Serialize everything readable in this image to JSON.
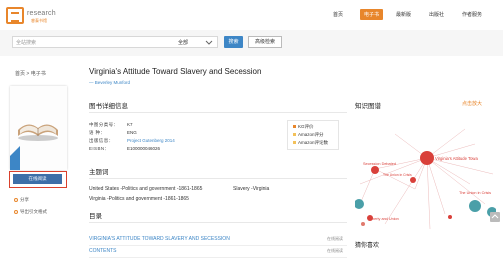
{
  "header": {
    "logo_text": "research",
    "logo_sub": "睿泰书馆",
    "nav": [
      {
        "label": "首页",
        "active": false
      },
      {
        "label": "电子书",
        "active": true
      },
      {
        "label": "最新版",
        "active": false
      },
      {
        "label": "出版社",
        "active": false
      },
      {
        "label": "作者服务",
        "active": false
      }
    ]
  },
  "search": {
    "placeholder": "全站搜索",
    "scope": "全部",
    "button": "搜索",
    "advanced": "高级检索"
  },
  "breadcrumb": "首页 > 电子书",
  "left": {
    "read_button": "在线阅读",
    "share": "分享",
    "export": "导出引文格式"
  },
  "book": {
    "title": "Virginia's Attitude Toward Slavery and Secession",
    "author": "— Beverley Munford"
  },
  "details": {
    "heading": "图书详细信息",
    "rows": [
      {
        "key": "中图分类号：",
        "value": "K7",
        "link": false
      },
      {
        "key": "语    种：",
        "value": "ENG",
        "link": false
      },
      {
        "key": "出版信息：",
        "value": "Project Gutenberg 2014",
        "link": true
      },
      {
        "key": "EISBN：",
        "value": "E100000046026",
        "link": false
      }
    ],
    "ratings": [
      {
        "label": "KG评价",
        "color": "#e8862b"
      },
      {
        "label": "Amazon评分",
        "color": "#f3c15a"
      },
      {
        "label": "Amazon评论数",
        "color": "#f3c15a"
      }
    ]
  },
  "subject": {
    "heading": "主题词",
    "line1a": "United States -Politics and government -1861-1865",
    "line1b": "Slavery -Virginia",
    "line2": "Virginia -Politics and government -1861-1865"
  },
  "toc": {
    "heading": "目录",
    "items": [
      {
        "label": "VIRGINIA'S ATTITUDE TOWARD SLAVERY AND SECESSION",
        "read": "在线阅读"
      },
      {
        "label": "CONTENTS",
        "read": "在线阅读"
      }
    ]
  },
  "knowledge_graph": {
    "heading": "知识图谱",
    "expand": "点击放大",
    "nodes": [
      {
        "label": "Virginia's Attitude Towa",
        "color": "#d9403a"
      },
      {
        "label": "Secession Debated",
        "color": "#d9403a"
      },
      {
        "label": "Liberty and Union",
        "color": "#d9403a"
      },
      {
        "label": "The Union in Crisis",
        "color": "#d9403a"
      },
      {
        "label": "The Union in Crisis",
        "color": "#d9403a"
      }
    ]
  },
  "also_like": "猜你喜欢"
}
